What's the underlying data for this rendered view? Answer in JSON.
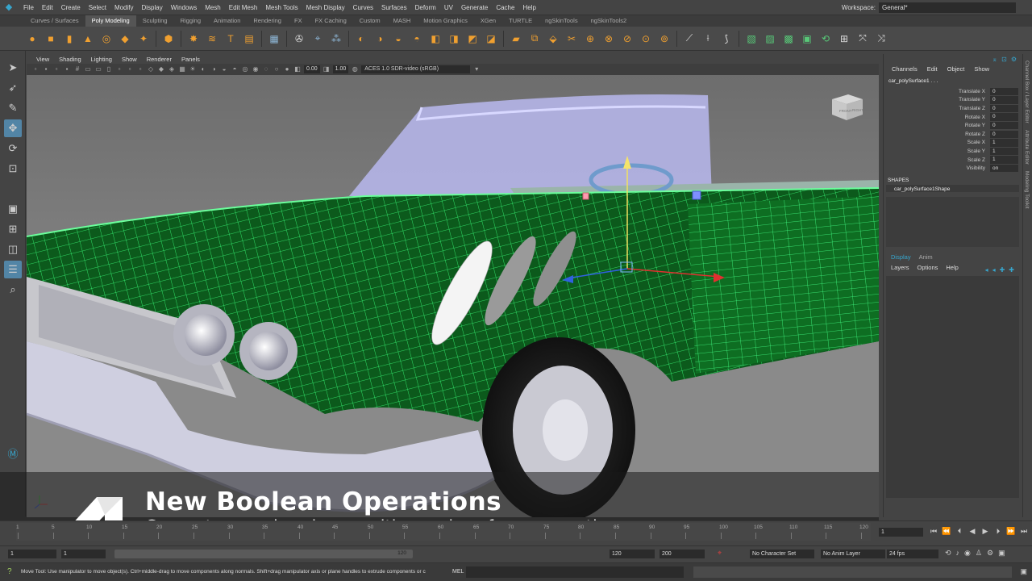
{
  "menubar": {
    "items": [
      "File",
      "Edit",
      "Create",
      "Select",
      "Modify",
      "Display",
      "Windows",
      "Mesh",
      "Edit Mesh",
      "Mesh Tools",
      "Mesh Display",
      "Curves",
      "Surfaces",
      "Deform",
      "UV",
      "Generate",
      "Cache",
      "Help"
    ],
    "workspace_label": "Workspace:",
    "workspace_value": "General*"
  },
  "shelf_tabs": [
    "Curves / Surfaces",
    "Poly Modeling",
    "Sculpting",
    "Rigging",
    "Animation",
    "Rendering",
    "FX",
    "FX Caching",
    "Custom",
    "MASH",
    "Motion Graphics",
    "XGen",
    "TURTLE",
    "ngSkinTools",
    "ngSkinTools2"
  ],
  "shelf_active": "Poly Modeling",
  "viewport": {
    "menu": [
      "View",
      "Shading",
      "Lighting",
      "Show",
      "Renderer",
      "Panels"
    ],
    "exposure": "0.00",
    "gamma": "1.00",
    "colorspace": "ACES 1.0 SDR-video (sRGB)",
    "viewcube_front": "FRONT",
    "viewcube_right": "RIGHT"
  },
  "overlay": {
    "title": "New Boolean Operations",
    "subtitle": "Generate complex shapes with a series of new operations"
  },
  "channel_box": {
    "tabs": [
      "Channels",
      "Edit",
      "Object",
      "Show"
    ],
    "object_name": "car_polySurface1 . . .",
    "attributes": [
      {
        "name": "Translate X",
        "value": "0"
      },
      {
        "name": "Translate Y",
        "value": "0"
      },
      {
        "name": "Translate Z",
        "value": "0"
      },
      {
        "name": "Rotate X",
        "value": "0"
      },
      {
        "name": "Rotate Y",
        "value": "0"
      },
      {
        "name": "Rotate Z",
        "value": "0"
      },
      {
        "name": "Scale X",
        "value": "1"
      },
      {
        "name": "Scale Y",
        "value": "1"
      },
      {
        "name": "Scale Z",
        "value": "1"
      },
      {
        "name": "Visibility",
        "value": "on"
      }
    ],
    "shapes_header": "SHAPES",
    "shape_name": "car_polySurface1Shape",
    "layer_tabs": [
      "Display",
      "Anim"
    ],
    "layer_menu": [
      "Layers",
      "Options",
      "Help"
    ]
  },
  "side_tabs": [
    "Channel Box / Layer Editor",
    "Attribute Editor",
    "Modeling Toolkit"
  ],
  "timeline": {
    "ticks": [
      "1",
      "5",
      "10",
      "15",
      "20",
      "25",
      "30",
      "35",
      "40",
      "45",
      "50",
      "55",
      "60",
      "65",
      "70",
      "75",
      "80",
      "85",
      "90",
      "95",
      "100",
      "105",
      "110",
      "115",
      "120"
    ],
    "current_frame": "1",
    "range_start": "1",
    "range_start_inner": "1",
    "range_end_inner": "120",
    "range_end": "120",
    "anim_end": "200",
    "character_set": "No Character Set",
    "anim_layer": "No Anim Layer",
    "fps": "24 fps"
  },
  "command_line": {
    "help_text": "Move Tool: Use manipulator to move object(s). Ctrl+middle-drag to move components along normals. Shift+drag manipulator axis or plane handles to extrude components or c",
    "mel_label": "MEL"
  },
  "colors": {
    "accent": "#37a5cc",
    "wireframe": "#39ff7a",
    "shelf_icon": "#f0a030"
  }
}
